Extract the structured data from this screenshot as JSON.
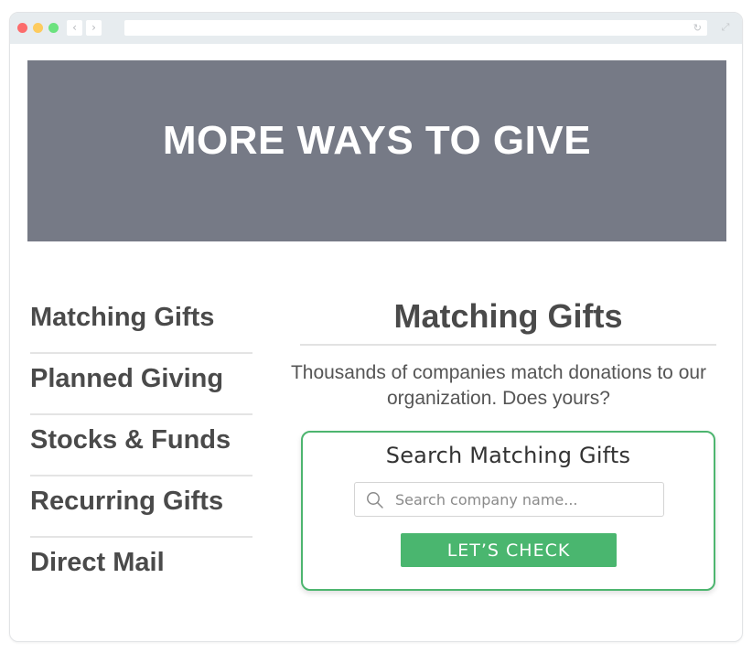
{
  "browser": {
    "back_icon": "‹",
    "forward_icon": "›",
    "reload_icon": "↻",
    "expand_icon": "⤢",
    "url": ""
  },
  "banner": {
    "title": "MORE WAYS TO GIVE",
    "background_color": "#767a86"
  },
  "sidebar": {
    "items": [
      {
        "label": "Matching Gifts"
      },
      {
        "label": "Planned Giving"
      },
      {
        "label": "Stocks & Funds"
      },
      {
        "label": "Recurring Gifts"
      },
      {
        "label": "Direct Mail"
      }
    ]
  },
  "main": {
    "title": "Matching Gifts",
    "description": "Thousands of companies match donations to our organization. Does yours?"
  },
  "search": {
    "title": "Search Matching Gifts",
    "placeholder": "Search company name...",
    "value": "",
    "button_label": "LET’S CHECK",
    "accent_color": "#4ab66f"
  }
}
